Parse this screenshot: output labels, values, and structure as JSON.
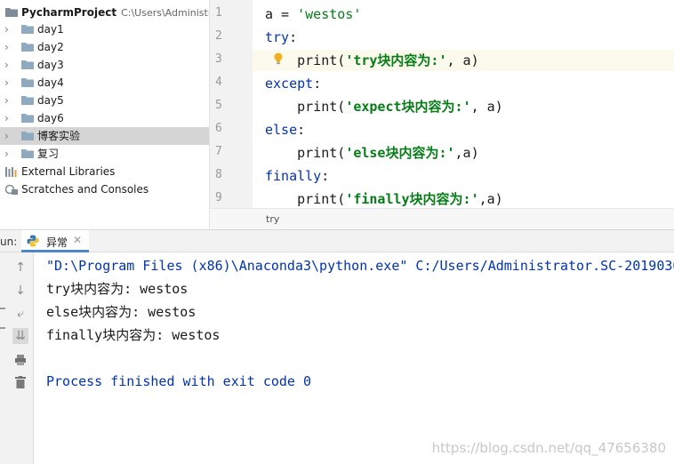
{
  "project": {
    "root_name": "PycharmProject",
    "root_path": "C:\\Users\\Administr",
    "items": [
      {
        "label": "day1"
      },
      {
        "label": "day2"
      },
      {
        "label": "day3"
      },
      {
        "label": "day4"
      },
      {
        "label": "day5"
      },
      {
        "label": "day6"
      },
      {
        "label": "博客实验",
        "selected": true
      },
      {
        "label": "复习"
      }
    ],
    "external_libraries": "External Libraries",
    "scratches": "Scratches and Consoles"
  },
  "editor": {
    "line_numbers": [
      "1",
      "2",
      "3",
      "4",
      "5",
      "6",
      "7",
      "8",
      "9"
    ],
    "lines": [
      {
        "p1": "a = ",
        "s1": "'westos'"
      },
      {
        "kw": "try",
        "rest": ":"
      },
      {
        "indent": "    ",
        "fn": "print(",
        "s1": "'try块内容为:'",
        "rest": ", a)"
      },
      {
        "kw": "except",
        "rest": ":"
      },
      {
        "indent": "    ",
        "fn": "print(",
        "s1": "'expect块内容为:'",
        "rest": ", a)"
      },
      {
        "kw": "else",
        "rest": ":"
      },
      {
        "indent": "    ",
        "fn": "print(",
        "s1": "'else块内容为:'",
        "rest": ",a)"
      },
      {
        "kw": "finally",
        "rest": ":"
      },
      {
        "indent": "    ",
        "fn": "print(",
        "s1": "'finally块内容为:'",
        "rest": ",a)"
      }
    ],
    "breadcrumb": "try",
    "bulb_icon": "lightbulb-icon"
  },
  "run": {
    "label": "un:",
    "tab_name": "异常",
    "close_glyph": "✕",
    "output": [
      "\"D:\\Program Files (x86)\\Anaconda3\\python.exe\" C:/Users/Administrator.SC-2019030",
      "try块内容为: westos",
      "else块内容为: westos",
      "finally块内容为: westos",
      "",
      "Process finished with exit code 0"
    ]
  },
  "watermark": "https://blog.csdn.net/qq_47656380",
  "colors": {
    "keyword": "#0033b3",
    "string": "#067d17",
    "selection": "#d5d5d5",
    "tab_underline": "#4a88c7",
    "folder": "#8fa9bf"
  }
}
